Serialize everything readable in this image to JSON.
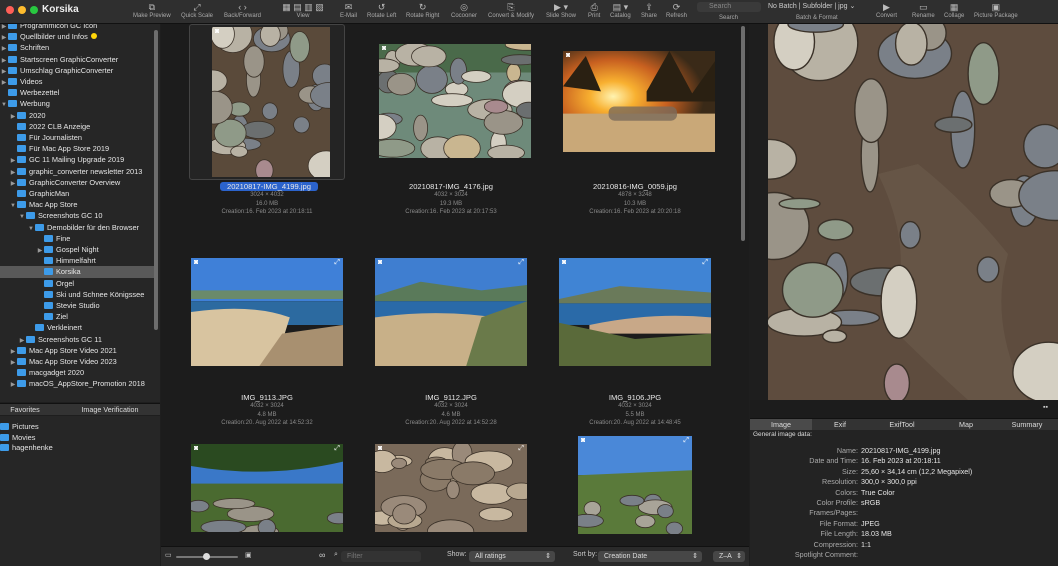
{
  "window": {
    "title": "Korsika"
  },
  "toolbar": {
    "buttons": [
      {
        "label": "Make Preview",
        "icon": "make-preview-icon"
      },
      {
        "label": "Quick Scale",
        "icon": "quick-scale-icon"
      },
      {
        "label": "Back/Forward",
        "icon": "back-forward-icon"
      },
      {
        "label": "View",
        "icon": "view-icon"
      },
      {
        "label": "E-Mail",
        "icon": "email-icon"
      },
      {
        "label": "Rotate Left",
        "icon": "rotate-left-icon"
      },
      {
        "label": "Rotate Right",
        "icon": "rotate-right-icon"
      },
      {
        "label": "Cocooner",
        "icon": "cocooner-icon"
      },
      {
        "label": "Convert & Modify",
        "icon": "convert-modify-icon"
      },
      {
        "label": "Slide Show",
        "icon": "slide-show-icon"
      },
      {
        "label": "Print",
        "icon": "print-icon"
      },
      {
        "label": "Catalog",
        "icon": "catalog-icon"
      },
      {
        "label": "Share",
        "icon": "share-icon"
      },
      {
        "label": "Refresh",
        "icon": "refresh-icon"
      },
      {
        "label": "Convert",
        "icon": "convert-icon"
      },
      {
        "label": "Rename",
        "icon": "rename-icon"
      },
      {
        "label": "Collage",
        "icon": "collage-icon"
      },
      {
        "label": "Picture Package",
        "icon": "picture-package-icon"
      }
    ],
    "search_placeholder": "Search",
    "search_label": "Search",
    "batch_value": "No Batch | Subfolder | jpg",
    "batch_label": "Batch & Format"
  },
  "sidebar": {
    "tree": [
      {
        "label": "Programmicon GC Icon",
        "level": 0,
        "arrow": "▶"
      },
      {
        "label": "Quellbilder und Infos",
        "level": 0,
        "arrow": "▶",
        "dot": true
      },
      {
        "label": "Schriften",
        "level": 0,
        "arrow": "▶"
      },
      {
        "label": "Startscreen GraphicConverter",
        "level": 0,
        "arrow": "▶"
      },
      {
        "label": "Umschlag GraphicConverter",
        "level": 0,
        "arrow": "▶"
      },
      {
        "label": "Videos",
        "level": 0,
        "arrow": "▶"
      },
      {
        "label": "Werbezettel",
        "level": 0,
        "arrow": ""
      },
      {
        "label": "Werbung",
        "level": 0,
        "arrow": "▼"
      },
      {
        "label": "2020",
        "level": 1,
        "arrow": "▶"
      },
      {
        "label": "2022 CLB Anzeige",
        "level": 1,
        "arrow": ""
      },
      {
        "label": "Für Journalisten",
        "level": 1,
        "arrow": ""
      },
      {
        "label": "Für Mac App Store 2019",
        "level": 1,
        "arrow": ""
      },
      {
        "label": "GC 11 Mailing Upgrade 2019",
        "level": 1,
        "arrow": "▶"
      },
      {
        "label": "graphic_converter newsletter 2013",
        "level": 1,
        "arrow": "▶"
      },
      {
        "label": "GraphicConverter Overview",
        "level": 1,
        "arrow": "▶"
      },
      {
        "label": "GraphicMan",
        "level": 1,
        "arrow": ""
      },
      {
        "label": "Mac App Store",
        "level": 1,
        "arrow": "▼"
      },
      {
        "label": "Screenshots GC 10",
        "level": 2,
        "arrow": "▼"
      },
      {
        "label": "Demobilder für den Browser",
        "level": 3,
        "arrow": "▼"
      },
      {
        "label": "Fine",
        "level": 4,
        "arrow": ""
      },
      {
        "label": "Gospel Night",
        "level": 4,
        "arrow": "▶"
      },
      {
        "label": "Himmelfahrt",
        "level": 4,
        "arrow": ""
      },
      {
        "label": "Korsika",
        "level": 4,
        "arrow": "",
        "selected": true
      },
      {
        "label": "Orgel",
        "level": 4,
        "arrow": ""
      },
      {
        "label": "Ski und Schnee Königssee",
        "level": 4,
        "arrow": ""
      },
      {
        "label": "Stevie Studio",
        "level": 4,
        "arrow": ""
      },
      {
        "label": "Ziel",
        "level": 4,
        "arrow": ""
      },
      {
        "label": "Verkleinert",
        "level": 3,
        "arrow": ""
      },
      {
        "label": "Screenshots GC 11",
        "level": 2,
        "arrow": "▶"
      },
      {
        "label": "Mac App Store Video 2021",
        "level": 1,
        "arrow": "▶"
      },
      {
        "label": "Mac App Store Video 2023",
        "level": 1,
        "arrow": "▶"
      },
      {
        "label": "macgadget 2020",
        "level": 1,
        "arrow": ""
      },
      {
        "label": "macOS_AppStore_Promotion 2018",
        "level": 1,
        "arrow": "▶"
      }
    ],
    "bottom_tabs": [
      "Favorites",
      "Image Verification"
    ],
    "favorites": [
      "Pictures",
      "Movies",
      "hagenhenke"
    ]
  },
  "grid": {
    "items": [
      {
        "name": "20210817-IMG_4199.jpg",
        "dims": "3024 × 4032",
        "size": "16.0 MB",
        "created": "Creation:16. Feb 2023 at 20:18:11",
        "scene": "rocks",
        "selected": true
      },
      {
        "name": "20210817-IMG_4176.jpg",
        "dims": "4032 × 3024",
        "size": "19.3 MB",
        "created": "Creation:16. Feb 2023 at 20:17:53",
        "scene": "river"
      },
      {
        "name": "20210816-IMG_0059.jpg",
        "dims": "4878 × 3248",
        "size": "10.3 MB",
        "created": "Creation:16. Feb 2023 at 20:20:18",
        "scene": "sunset"
      },
      {
        "name": "IMG_9113.JPG",
        "dims": "4032 × 3024",
        "size": "4.8 MB",
        "created": "Creation:20. Aug 2022 at 14:52:32",
        "scene": "beach"
      },
      {
        "name": "IMG_9112.JPG",
        "dims": "4032 × 3024",
        "size": "4.6 MB",
        "created": "Creation:20. Aug 2022 at 14:52:28",
        "scene": "bay"
      },
      {
        "name": "IMG_9106.JPG",
        "dims": "4032 × 3024",
        "size": "5.5 MB",
        "created": "Creation:20. Aug 2022 at 14:48:45",
        "scene": "coast"
      },
      {
        "name": "",
        "dims": "",
        "size": "",
        "created": "",
        "scene": "forest"
      },
      {
        "name": "",
        "dims": "",
        "size": "",
        "created": "",
        "scene": "water"
      },
      {
        "name": "",
        "dims": "",
        "size": "",
        "created": "",
        "scene": "valley"
      }
    ]
  },
  "bottombar": {
    "filter_placeholder": "Filter",
    "show_label": "Show:",
    "show_value": "All ratings",
    "sort_label": "Sort by:",
    "sort_value": "Creation Date",
    "order_value": "Z–A"
  },
  "info": {
    "tabs": [
      "Image",
      "Exif",
      "ExifTool",
      "Map",
      "Summary"
    ],
    "active_tab": "Image",
    "section_title": "General image data:",
    "rows": [
      {
        "label": "Name:",
        "value": "20210817-IMG_4199.jpg"
      },
      {
        "label": "Date and Time:",
        "value": "16. Feb 2023 at 20:18:11"
      },
      {
        "label": "Size:",
        "value": "25,60 × 34,14 cm (12,2 Megapixel)"
      },
      {
        "label": "Resolution:",
        "value": "300,0 × 300,0 ppi"
      },
      {
        "label": "Colors:",
        "value": "True Color"
      },
      {
        "label": "Color Profile:",
        "value": "sRGB"
      },
      {
        "label": "Frames/Pages:",
        "value": ""
      },
      {
        "label": "File Format:",
        "value": "JPEG"
      },
      {
        "label": "File Length:",
        "value": "18.03 MB"
      },
      {
        "label": "Compression:",
        "value": "1:1"
      },
      {
        "label": "Spotlight Comment:",
        "value": ""
      }
    ]
  },
  "colors": {
    "accent": "#2b63cc",
    "folder": "#3d9be9",
    "traffic_red": "#ff5f57",
    "traffic_yellow": "#febc2e",
    "traffic_green": "#28c840"
  }
}
